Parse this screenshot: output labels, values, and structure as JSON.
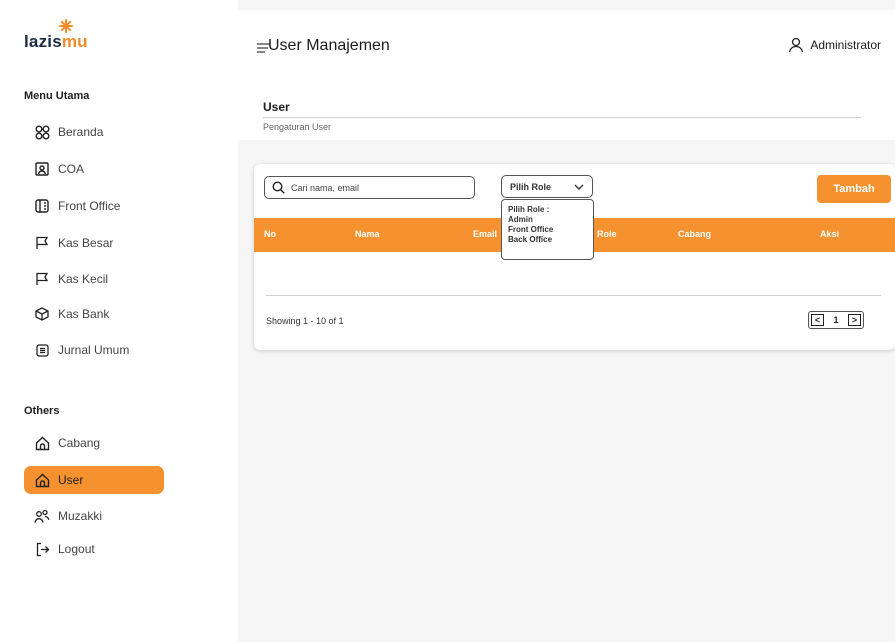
{
  "brand": {
    "part1": "lazis",
    "part2": "mu",
    "accent": "#f28c28"
  },
  "sidebar": {
    "main_title": "Menu Utama",
    "main_items": [
      {
        "label": "Beranda",
        "icon": "grid-icon"
      },
      {
        "label": "COA",
        "icon": "user-card-icon"
      },
      {
        "label": "Front Office",
        "icon": "building-icon"
      },
      {
        "label": "Kas Besar",
        "icon": "flag-icon"
      },
      {
        "label": "Kas Kecil",
        "icon": "flag-icon"
      },
      {
        "label": "Kas Bank",
        "icon": "box-icon"
      },
      {
        "label": "Jurnal Umum",
        "icon": "document-icon"
      }
    ],
    "others_title": "Others",
    "others_items": [
      {
        "label": "Cabang",
        "icon": "home-icon"
      },
      {
        "label": "User",
        "icon": "home-icon",
        "active": true
      },
      {
        "label": "Muzakki",
        "icon": "users-icon"
      },
      {
        "label": "Logout",
        "icon": "logout-icon"
      }
    ]
  },
  "header": {
    "title": "User Manajemen",
    "user_name": "Administrator"
  },
  "section": {
    "heading": "User",
    "subtitle": "Pengaturan User"
  },
  "toolbar": {
    "search_placeholder": "Cari nama, email",
    "role_select_label": "Pilih Role",
    "add_label": "Tambah"
  },
  "table": {
    "columns": [
      "No",
      "Nama",
      "Email",
      "Role",
      "Cabang",
      "Aksi"
    ],
    "rows": []
  },
  "role_dropdown": {
    "options": [
      "Pilih Role :",
      "Admin",
      "Front Office",
      "Back Office"
    ]
  },
  "pagination": {
    "showing": "Showing 1 - 10 of 1",
    "prev": "<",
    "page": "1",
    "next": ">"
  },
  "colors": {
    "accent": "#f5912f",
    "main_bg": "#f6f6f6"
  }
}
